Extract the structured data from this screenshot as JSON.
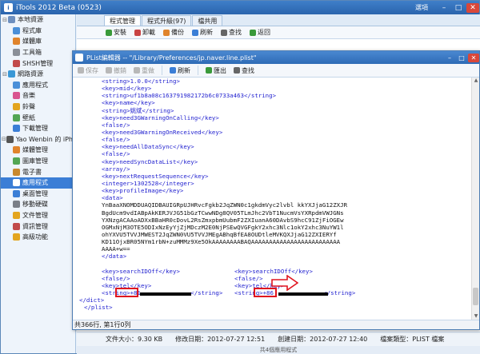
{
  "app": {
    "title": "iTools 2012 Beta (0523)",
    "options_label": "選項",
    "min": "–",
    "max": "□",
    "close": "✕"
  },
  "sidebar": [
    {
      "label": "本地資源",
      "level": 0,
      "toggle": "⊟",
      "color": "#6d8fbf",
      "icon": "computer-icon"
    },
    {
      "label": "程式庫",
      "level": 1,
      "color": "#4a8fd8",
      "icon": "apps-icon"
    },
    {
      "label": "媒體庫",
      "level": 1,
      "color": "#e0842c",
      "icon": "media-icon"
    },
    {
      "label": "工具箱",
      "level": 1,
      "color": "#8a8f98",
      "icon": "tools-icon"
    },
    {
      "label": "SHSH管理",
      "level": 1,
      "color": "#c24a4a",
      "icon": "shsh-icon"
    },
    {
      "label": "網路資源",
      "level": 0,
      "toggle": "⊟",
      "color": "#3a98d6",
      "icon": "globe-icon"
    },
    {
      "label": "應用程式",
      "level": 1,
      "color": "#4a8fd8",
      "icon": "apps-icon"
    },
    {
      "label": "音樂",
      "level": 1,
      "color": "#d9548f",
      "icon": "music-icon"
    },
    {
      "label": "鈴聲",
      "level": 1,
      "color": "#e3a51f",
      "icon": "bell-icon"
    },
    {
      "label": "壁紙",
      "level": 1,
      "color": "#53a653",
      "icon": "wallpaper-icon"
    },
    {
      "label": "下載管理",
      "level": 1,
      "color": "#3b7ed6",
      "icon": "download-icon"
    },
    {
      "label": "Yao Wenbin 的 iPhone",
      "level": 0,
      "toggle": "⊟",
      "color": "#555555",
      "icon": "phone-icon"
    },
    {
      "label": "媒體管理",
      "level": 1,
      "color": "#e0842c",
      "icon": "media-icon"
    },
    {
      "label": "圖庫管理",
      "level": 1,
      "color": "#53a653",
      "icon": "photo-icon"
    },
    {
      "label": "電子書",
      "level": 1,
      "color": "#c9892e",
      "icon": "book-icon"
    },
    {
      "label": "應用程式",
      "level": 1,
      "color": "#ffffff",
      "icon": "apps-icon",
      "selected": true
    },
    {
      "label": "桌面管理",
      "level": 1,
      "color": "#3b7ed6",
      "icon": "desktop-icon"
    },
    {
      "label": "移動硬碟",
      "level": 1,
      "color": "#7a7f88",
      "icon": "disk-icon"
    },
    {
      "label": "文件管理",
      "level": 1,
      "color": "#e3a51f",
      "icon": "folder-icon"
    },
    {
      "label": "資訊管理",
      "level": 1,
      "color": "#c24a4a",
      "icon": "info-icon"
    },
    {
      "label": "高級功能",
      "level": 1,
      "color": "#e3a51f",
      "icon": "star-icon"
    }
  ],
  "content": {
    "tabs": [
      "程式管理",
      "程式升級(97)",
      "檔共用"
    ],
    "toolbar": [
      "安裝",
      "卸載",
      "備份",
      "刷新",
      "查找",
      "返回"
    ],
    "status": {
      "size": "文件大小：9.30 KB",
      "modified": "修改日期：2012-07-27 12:51",
      "created": "創建日期：2012-07-27 12:40",
      "type": "檔案類型：PLIST 檔案"
    },
    "bottom": "共4個應用程式"
  },
  "plist": {
    "title": "PList編輯器 -- \"/Library/Preferences/jp.naver.line.plist\"",
    "toolbar": [
      {
        "label": "保存",
        "disabled": true,
        "icon": "save-icon"
      },
      {
        "label": "撤銷",
        "disabled": true,
        "icon": "undo-icon"
      },
      {
        "label": "重做",
        "disabled": true,
        "icon": "redo-icon"
      },
      {
        "label": "刷新",
        "disabled": false,
        "icon": "refresh-icon"
      },
      {
        "label": "匯出",
        "disabled": false,
        "icon": "export-icon"
      },
      {
        "label": "查找",
        "disabled": false,
        "icon": "search-icon"
      }
    ],
    "lines": [
      {
        "indent": "    ",
        "text": "<string>1.0.0</string>"
      },
      {
        "indent": "    ",
        "text": "<key>mid</key>"
      },
      {
        "indent": "    ",
        "text": "<string>uf1b8a08c163791982172b6c0733a463</string>"
      },
      {
        "indent": "    ",
        "text": "<key>name</key>"
      },
      {
        "indent": "    ",
        "text": "<string>姚斌</string>"
      },
      {
        "indent": "    ",
        "text": "<key>need3GWarningOnCalling</key>"
      },
      {
        "indent": "    ",
        "text": "<false/>"
      },
      {
        "indent": "    ",
        "text": "<key>need3GWarningOnReceived</key>"
      },
      {
        "indent": "    ",
        "text": "<false/>"
      },
      {
        "indent": "    ",
        "text": "<key>needAllDataSync</key>"
      },
      {
        "indent": "    ",
        "text": "<false/>"
      },
      {
        "indent": "    ",
        "text": "<key>needSyncDataList</key>"
      },
      {
        "indent": "    ",
        "text": "<array/>"
      },
      {
        "indent": "    ",
        "text": "<key>nextRequestSequence</key>"
      },
      {
        "indent": "    ",
        "text": "<integer>1302528</integer>"
      },
      {
        "indent": "    ",
        "text": "<key>profileImage</key>"
      },
      {
        "indent": "    ",
        "text": "<data>"
      },
      {
        "indent": "    ",
        "text": "YnBaaXNOMDDUAQIDBAUIGRpUJHRvcFgkb2JqZWN0c1gkdmVyc2lvbl kkYXJjaG12ZXJR"
      },
      {
        "indent": "    ",
        "text": "BgdUcm9vdIABpAkKERJVJG51bGzTCwwNDg8QV05TLmJhc2VbT1NucmVsYXRpdmVWJGNs"
      },
      {
        "indent": "    ",
        "text": "YXNzgACAAoADXxBBaHR0cDovL2RsZmxpbmUubmF2ZXIuanA60DAvbS9hcC91ZjFiOGEw"
      },
      {
        "indent": "    ",
        "text": "OGMxNjM3OTE5ODIxNzEyYjZjMDczM2E0NjPSEwQVGFgkY2xhc3Nlc1okY2xhc3NuYW1l"
      },
      {
        "indent": "    ",
        "text": "ohYXVU5TVVJMWEST2JqZWN0VU5TVVJMEgABhqBfEA8OUDtleMVKQXJjaG12ZXIERYf"
      },
      {
        "indent": "    ",
        "text": "KD11OjxBR05NYm1rbN+zuMMMz9Xe5OkAAAAAAAABAQAAAAAAAAAAAAAAAAAAAAAAAAA"
      },
      {
        "indent": "    ",
        "text": "AAAA+w=="
      },
      {
        "indent": "    ",
        "text": "</data>"
      }
    ],
    "compare_left": [
      "<key>searchIDOff</key>",
      "<false/>",
      "<key>tel</key>",
      "<string>+81              </string>"
    ],
    "compare_right": [
      "<key>searchIDOff</key>",
      "<false/>",
      "<key>tel</key>",
      "<string>+86              </string>"
    ],
    "tail": [
      "</dict>",
      "</plist>"
    ],
    "status": "共366行, 第1行0列"
  }
}
